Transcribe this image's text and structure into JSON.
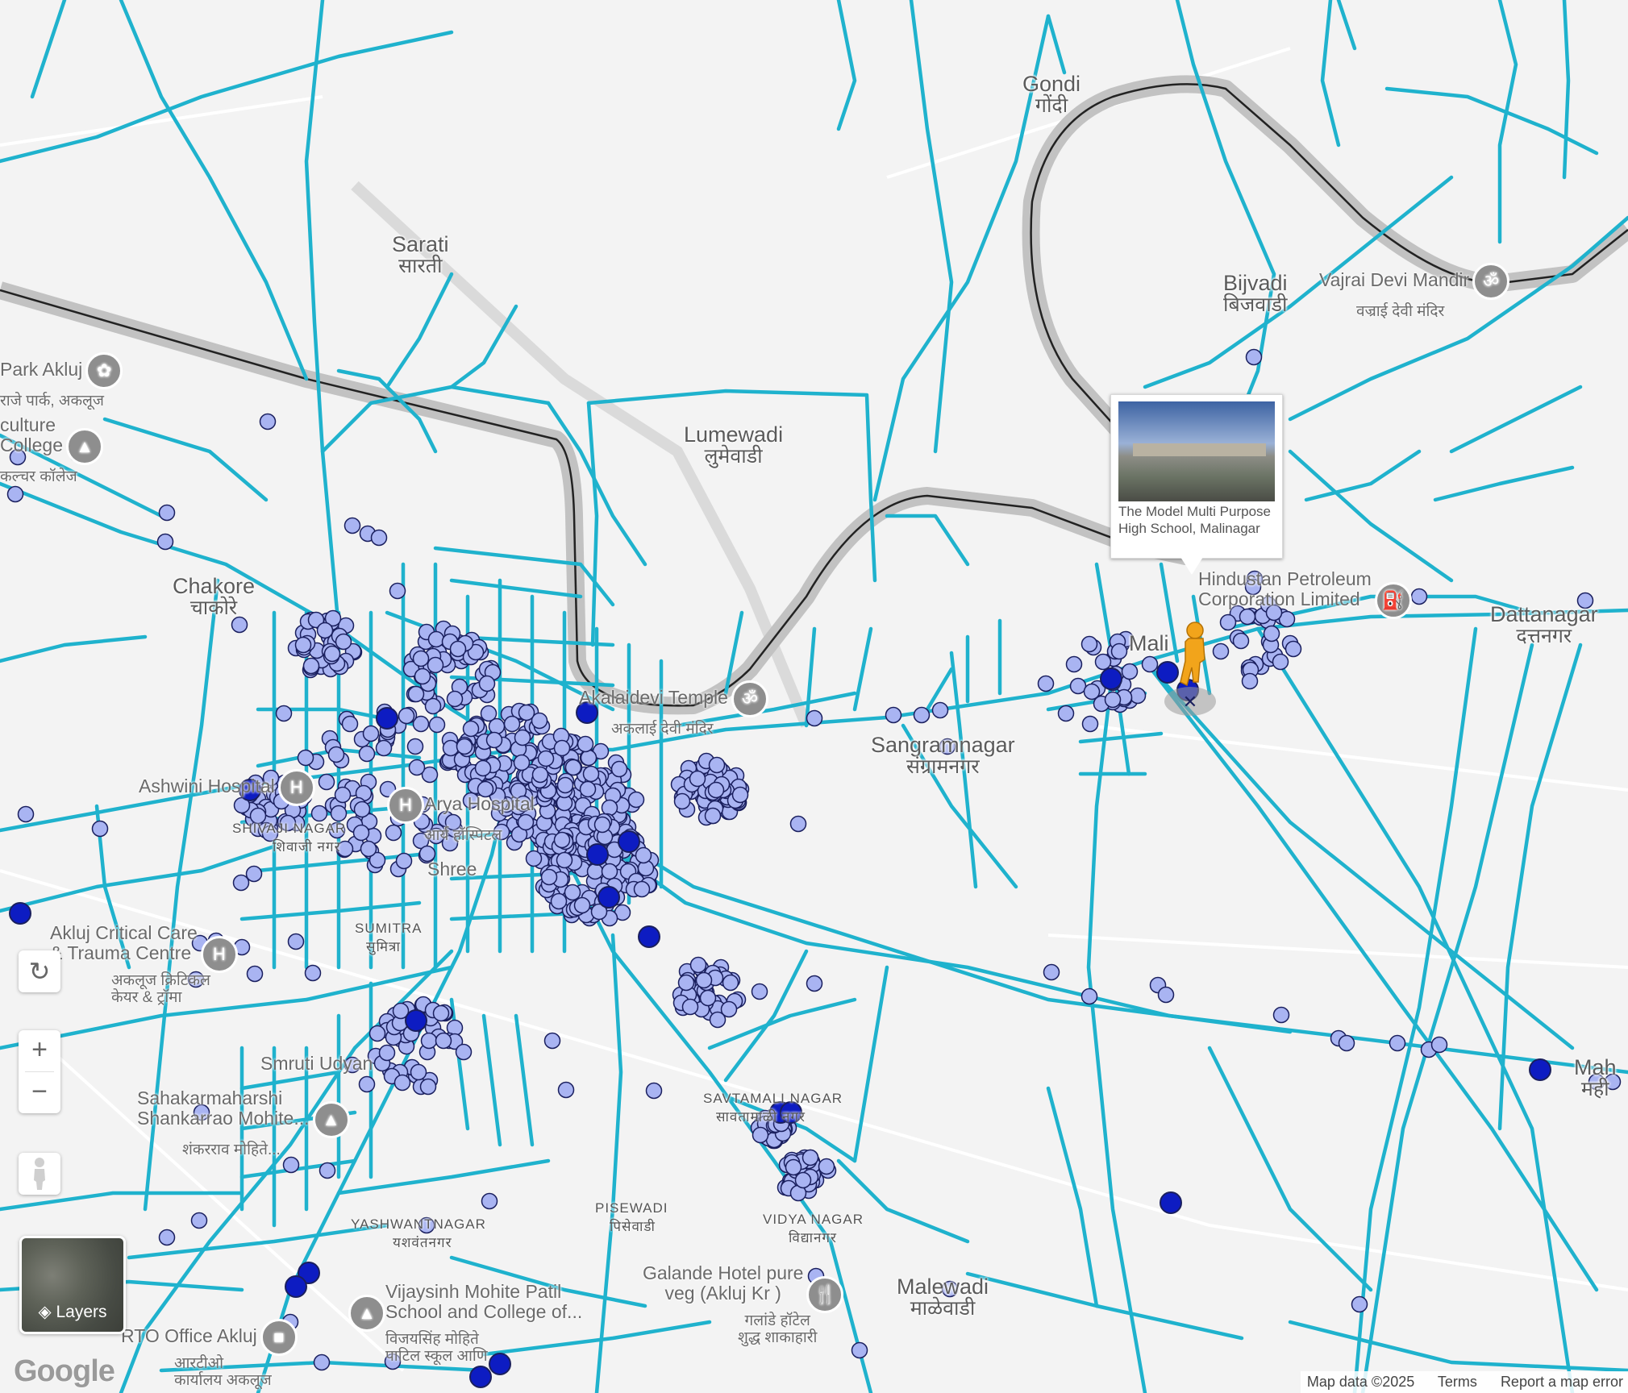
{
  "colors": {
    "background": "#f3f3f3",
    "road_overlay": "#1fb2cd",
    "point_fill": "#a9b4f2",
    "point_stroke": "#1a1f5e",
    "highlight_point": "#0d1cc2",
    "railway_casing": "#bdbdbd",
    "pegman": "#f2a41b"
  },
  "places": [
    {
      "id": "sarati",
      "en": "Sarati",
      "hi": "सारती"
    },
    {
      "id": "lumewadi",
      "en": "Lumewadi",
      "hi": "लुमेवाडी"
    },
    {
      "id": "chakore",
      "en": "Chakore",
      "hi": "चाकोरे"
    },
    {
      "id": "gondi",
      "en": "Gondi",
      "hi": "गोंदी"
    },
    {
      "id": "bijvadi",
      "en": "Bijvadi",
      "hi": "बिजवाडी"
    },
    {
      "id": "sangramnagar",
      "en": "Sangramnagar",
      "hi": "संग्रामनगर"
    },
    {
      "id": "malewadi",
      "en": "Malewadi",
      "hi": "माळेवाडी"
    },
    {
      "id": "dattanagar",
      "en": "Dattanagar",
      "hi": "दत्तनगर"
    },
    {
      "id": "malinagar",
      "en": "Mali",
      "hi": ""
    },
    {
      "id": "mahi",
      "en": "Mah",
      "hi": "मही"
    }
  ],
  "pois": [
    {
      "id": "park-akluj",
      "label": "Park Akluj",
      "sub": "राजे पार्क, अकलूज",
      "icon": "park-icon"
    },
    {
      "id": "culture-college",
      "label": "culture\nCollege",
      "sub": "कल्चर कॉलेज",
      "icon": "school-icon"
    },
    {
      "id": "vajrai",
      "label": "Vajrai Devi Mandir",
      "sub": "वज्राई देवी मंदिर",
      "icon": "temple-icon"
    },
    {
      "id": "hpcl",
      "label": "Hindustan Petroleum\nCorporation Limited",
      "sub": "",
      "icon": "fuel-icon"
    },
    {
      "id": "akalaidevi",
      "label": "Akalaidevi Temple",
      "sub": "अकलाई देवी मंदिर",
      "icon": "temple-icon"
    },
    {
      "id": "ashwini",
      "label": "Ashwini Hospital",
      "sub": "",
      "icon": "hospital-icon"
    },
    {
      "id": "arya",
      "label": "Arya Hospital",
      "sub": "आर्य हॉस्पिटल",
      "icon": "hospital-icon"
    },
    {
      "id": "akluj-critical",
      "label": "Akluj Critical Care\n& Trauma Centre",
      "sub": "अकलूज क्रिटिकल\nकेयर & ट्रॉमा",
      "icon": "hospital-icon"
    },
    {
      "id": "sahakar",
      "label": "Sahakarmaharshi\nShankarrao Mohite...",
      "sub": "शंकरराव मोहिते...",
      "icon": "school-icon"
    },
    {
      "id": "vijaysinh",
      "label": "Vijaysinh Mohite Patil\nSchool and College of...",
      "sub": "विजयसिंह मोहिते\nपाटिल स्कूल आणि",
      "icon": "school-icon"
    },
    {
      "id": "rto",
      "label": "RTO Office Akluj",
      "sub": "आरटीओ\nकार्यालय अकलूज",
      "icon": "building-icon"
    },
    {
      "id": "galande",
      "label": "Galande Hotel pure\nveg (Akluj Kr )",
      "sub": "गलांडे हॉटेल\nशुद्ध शाकाहारी",
      "icon": "restaurant-icon"
    }
  ],
  "area_labels": [
    {
      "id": "shivaji-nagar",
      "text": "SHIVAJI NAGAR",
      "sub": "शिवाजी नगर"
    },
    {
      "id": "sumitra",
      "text": "SUMITRA",
      "sub": "सुमित्रा"
    },
    {
      "id": "yashwantnagar",
      "text": "YASHWANTNAGAR",
      "sub": "यशवंतनगर"
    },
    {
      "id": "pisewadi",
      "text": "PISEWADI",
      "sub": "पिसेवाडी"
    },
    {
      "id": "vidyanagar",
      "text": "VIDYA NAGAR",
      "sub": "विद्यानगर"
    },
    {
      "id": "sawtamali",
      "text": "SAVTAMALI NAGAR",
      "sub": "सावतामाळी नगर"
    },
    {
      "id": "smruti",
      "text": "Smruti Udyan",
      "sub": ""
    },
    {
      "id": "shree",
      "text": "Shree",
      "sub": ""
    }
  ],
  "street_view_card": {
    "caption": "The Model Multi Purpose High School, Malinagar"
  },
  "controls": {
    "rotate_icon": "rotate-icon",
    "zoom_in_label": "+",
    "zoom_out_label": "−",
    "pegman_icon": "pegman-icon",
    "layers_label": "Layers"
  },
  "branding": {
    "logo": "Google"
  },
  "attribution": {
    "map_data": "Map data ©2025",
    "terms": "Terms",
    "report": "Report a map error"
  }
}
